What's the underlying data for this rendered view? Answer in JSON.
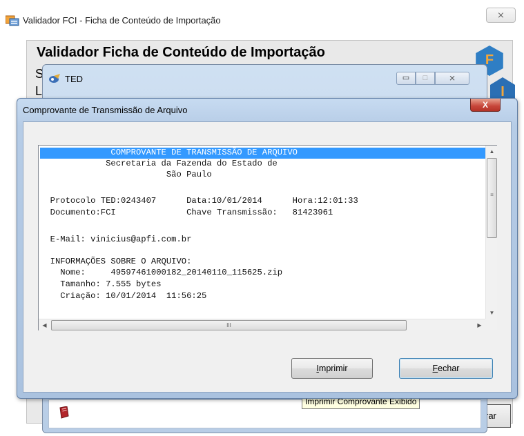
{
  "main_window": {
    "title": "Validador FCI - Ficha de Conteúdo de Importação",
    "close_glyph": "⨯",
    "heading": "Validador Ficha de Conteúdo de Importação",
    "peek_text_1": "S",
    "peek_text_2": "L",
    "logo_letters": [
      "F",
      "I"
    ],
    "partial_button_label": "rar"
  },
  "ted_window": {
    "title": "TED",
    "minimize_glyph": "▭",
    "maximize_glyph": "□",
    "close_glyph": "⨯"
  },
  "dialog": {
    "title": "Comprovante de Transmissão de Arquivo",
    "close_glyph": "X",
    "receipt_lines": [
      "              COMPROVANTE DE TRANSMISSÃO DE ARQUIVO",
      "             Secretaria da Fazenda do Estado de",
      "                         São Paulo",
      "",
      "  Protocolo TED:0243407      Data:10/01/2014      Hora:12:01:33",
      "  Documento:FCI              Chave Transmissão:   81423961",
      "",
      "  E-Mail: vinicius@apfi.com.br",
      "",
      "  INFORMAÇÕES SOBRE O ARQUIVO:",
      "    Nome:     49597461000182_20140110_115625.zip",
      "    Tamanho: 7.555 bytes",
      "    Criação: 10/01/2014  11:56:25"
    ],
    "scroll_glyphs": {
      "up": "▲",
      "down": "▼",
      "left": "◀",
      "right": "▶",
      "vgrip": "≡",
      "hgrip": "III"
    },
    "buttons": {
      "print_accel": "I",
      "print_rest": "mprimir",
      "close_accel": "F",
      "close_rest": "echar"
    }
  },
  "tooltip": {
    "text": "Imprimir Comprovante Exibido"
  },
  "colors": {
    "selection_highlight": "#3399ff",
    "dialog_close_red": "#c7463a",
    "tooltip_bg": "#ffffe1",
    "logo_blue": "#2f7ec4",
    "logo_letter_orange": "#f3a63a"
  }
}
